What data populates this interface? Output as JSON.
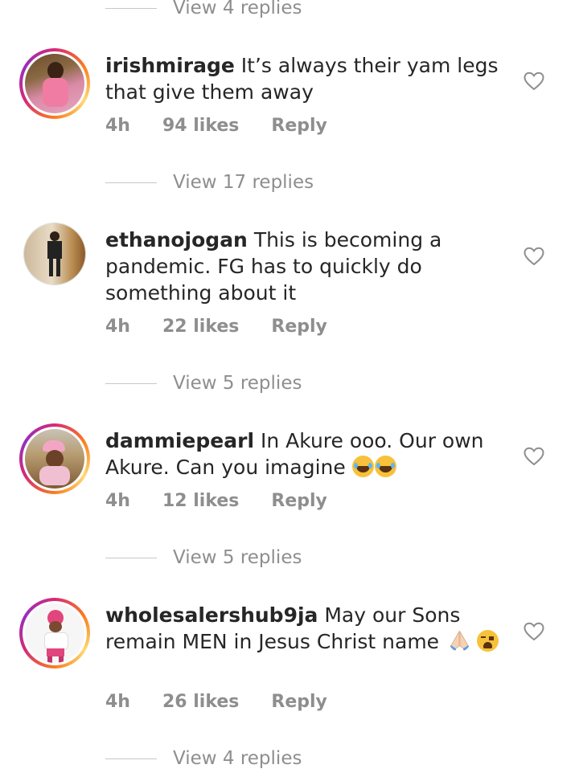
{
  "threads": [
    {
      "view_replies": "View 4 replies"
    },
    {
      "username": "irishmirage",
      "text": "It’s always their yam legs that give them away",
      "time": "4h",
      "likes": "94 likes",
      "reply": "Reply",
      "view_replies": "View 17 replies"
    },
    {
      "username": "ethanojogan",
      "text": "This is becoming a pandemic. FG has to quickly do something about it",
      "time": "4h",
      "likes": "22 likes",
      "reply": "Reply",
      "view_replies": "View 5 replies"
    },
    {
      "username": "dammiepearl",
      "text": "In Akure ooo. Our own Akure. Can you imagine",
      "emoji": [
        "face-with-tears-of-joy",
        "face-with-tears-of-joy"
      ],
      "time": "4h",
      "likes": "12 likes",
      "reply": "Reply",
      "view_replies": "View 5 replies"
    },
    {
      "username": "wholesalershub9ja",
      "text": "May our Sons remain MEN in Jesus Christ name",
      "emoji": [
        "folded-hands",
        "weary-face"
      ],
      "time": "4h",
      "likes": "26 likes",
      "reply": "Reply",
      "view_replies": "View 4 replies"
    }
  ],
  "colors": {
    "text": "#262626",
    "muted": "#8e8e8e",
    "divider": "#c7c7c7"
  }
}
